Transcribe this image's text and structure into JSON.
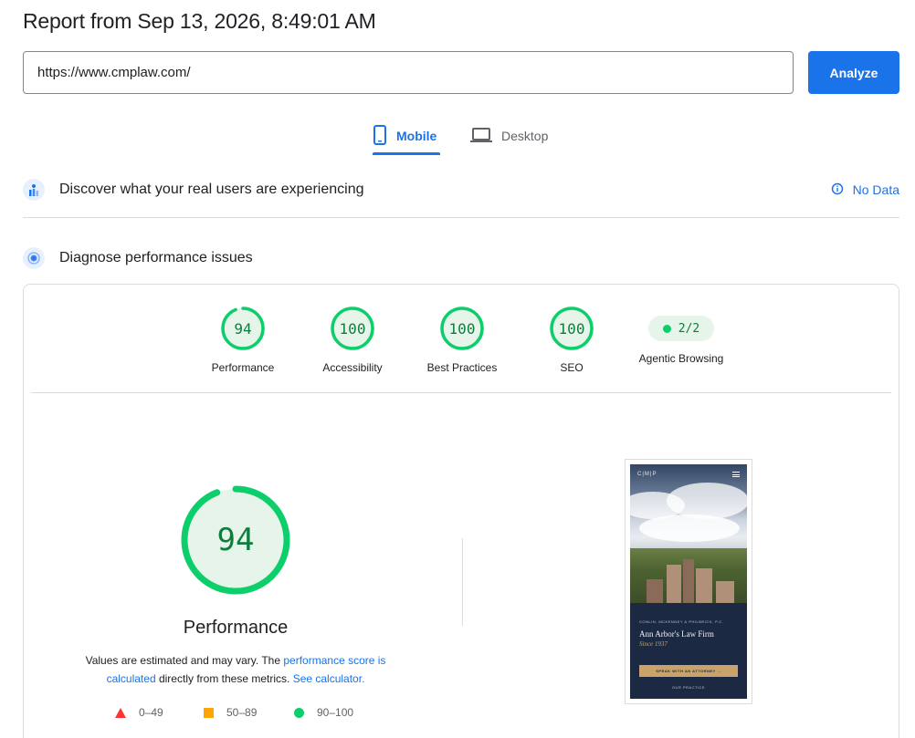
{
  "report": {
    "title": "Report from Sep 13, 2026, 8:49:01 AM"
  },
  "search": {
    "url": "https://www.cmplaw.com/",
    "analyze_label": "Analyze"
  },
  "tabs": [
    {
      "label": "Mobile",
      "icon": "smartphone-icon",
      "active": true
    },
    {
      "label": "Desktop",
      "icon": "laptop-icon",
      "active": false
    }
  ],
  "field_data": {
    "title": "Discover what your real users are experiencing",
    "status": "No Data"
  },
  "lab_data": {
    "title": "Diagnose performance issues"
  },
  "scores": [
    {
      "label": "Performance",
      "value": "94",
      "fraction": 0.94
    },
    {
      "label": "Accessibility",
      "value": "100",
      "fraction": 1.0
    },
    {
      "label": "Best Practices",
      "value": "100",
      "fraction": 1.0
    },
    {
      "label": "SEO",
      "value": "100",
      "fraction": 1.0
    }
  ],
  "agentic": {
    "label": "Agentic Browsing",
    "value": "2/2"
  },
  "performance_detail": {
    "score": "94",
    "fraction": 0.94,
    "label": "Performance",
    "explain_prefix": "Values are estimated and may vary. The",
    "explain_link1": "performance score is calculated",
    "explain_middle": "directly from these metrics.",
    "explain_link2": "See calculator."
  },
  "legend": [
    {
      "range": "0–49",
      "color": "#ff3333"
    },
    {
      "range": "50–89",
      "color": "#ffa400"
    },
    {
      "range": "90–100",
      "color": "#0cce6b"
    }
  ],
  "screenshot": {
    "brand": "C|M|P",
    "tagline": "CONLIN, MCKENNEY & PHILBRICK, P.C.",
    "heading": "Ann Arbor's Law Firm",
    "since": "Since 1937",
    "cta": "SPEAK WITH AN ATTORNEY →",
    "link": "OUR PRACTICE"
  },
  "colors": {
    "accent": "#1a73e8",
    "pass": "#0cce6b",
    "pass_text": "#0c7d3c",
    "pass_bg": "#e6f4ea"
  }
}
